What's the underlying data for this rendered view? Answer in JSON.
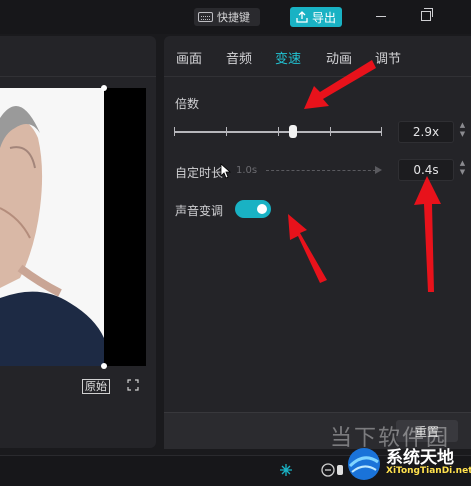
{
  "topbar": {
    "shortcut_label": "快捷键",
    "export_label": "导出"
  },
  "player": {
    "original_label": "原始"
  },
  "tabs": [
    {
      "label": "画面"
    },
    {
      "label": "音频"
    },
    {
      "label": "变速",
      "active": true
    },
    {
      "label": "动画"
    },
    {
      "label": "调节"
    }
  ],
  "speed": {
    "multiplier_label": "倍数",
    "multiplier_value": "2.9x",
    "custom_duration_label": "自定时长",
    "custom_duration_start": "1.0s",
    "custom_duration_value": "0.4s",
    "pitch_label": "声音变调",
    "pitch_enabled": true
  },
  "footer": {
    "reset_label": "重置"
  },
  "watermark": {
    "text": "当下软件园",
    "brand": "系统天地",
    "brand_url": "XiTongTianDi.net"
  },
  "colors": {
    "accent": "#19b2c4",
    "arrow": "#e8121b",
    "active_tab": "#22c3d3"
  }
}
